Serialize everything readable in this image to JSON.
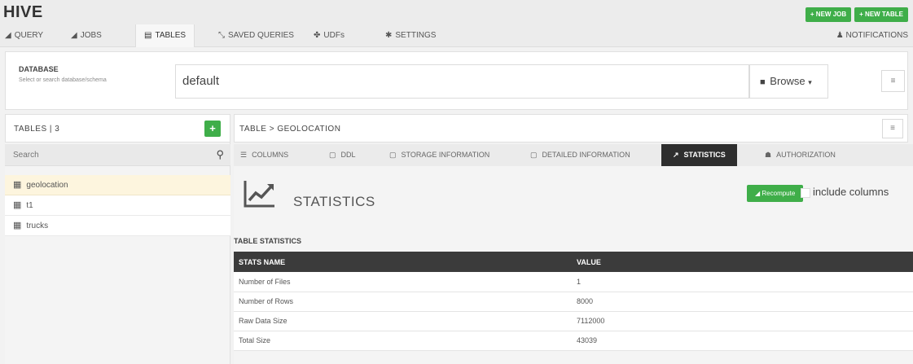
{
  "app": {
    "title": "HIVE"
  },
  "top_actions": {
    "new_job": "+ NEW JOB",
    "new_table": "+ NEW TABLE"
  },
  "nav": {
    "items": [
      {
        "label": "QUERY",
        "icon": "paper-plane-icon"
      },
      {
        "label": "JOBS",
        "icon": "paper-plane-icon"
      },
      {
        "label": "TABLES",
        "icon": "table-icon"
      },
      {
        "label": "SAVED QUERIES",
        "icon": "link-icon"
      },
      {
        "label": "UDFs",
        "icon": "function-icon"
      },
      {
        "label": "SETTINGS",
        "icon": "gear-icon"
      }
    ],
    "active": "TABLES",
    "notifications": "NOTIFICATIONS"
  },
  "database": {
    "label": "DATABASE",
    "help": "Select or search database/schema",
    "value": "default",
    "browse": "Browse"
  },
  "tables_panel": {
    "title": "TABLES | 3",
    "search_placeholder": "Search",
    "items": [
      "geolocation",
      "t1",
      "trucks"
    ],
    "selected": "geolocation"
  },
  "detail": {
    "breadcrumb": "TABLE > GEOLOCATION",
    "tabs": [
      {
        "label": "COLUMNS",
        "icon": "list-icon"
      },
      {
        "label": "DDL",
        "icon": "file-icon"
      },
      {
        "label": "STORAGE INFORMATION",
        "icon": "file-icon"
      },
      {
        "label": "DETAILED INFORMATION",
        "icon": "file-icon"
      },
      {
        "label": "STATISTICS",
        "icon": "line-chart-icon"
      },
      {
        "label": "AUTHORIZATION",
        "icon": "users-icon"
      }
    ],
    "active_tab": "STATISTICS"
  },
  "statistics": {
    "heading": "STATISTICS",
    "recompute": "Recompute",
    "include_columns": "include columns",
    "include_columns_checked": false,
    "table_stats_label": "TABLE STATISTICS",
    "columns": [
      "STATS NAME",
      "VALUE"
    ],
    "rows": [
      [
        "Number of Files",
        "1"
      ],
      [
        "Number of Rows",
        "8000"
      ],
      [
        "Raw Data Size",
        "7112000"
      ],
      [
        "Total Size",
        "43039"
      ]
    ]
  },
  "colors": {
    "accent_green": "#3fae49",
    "dark_header": "#3b3b3b",
    "selected_row": "#fdf5de"
  }
}
